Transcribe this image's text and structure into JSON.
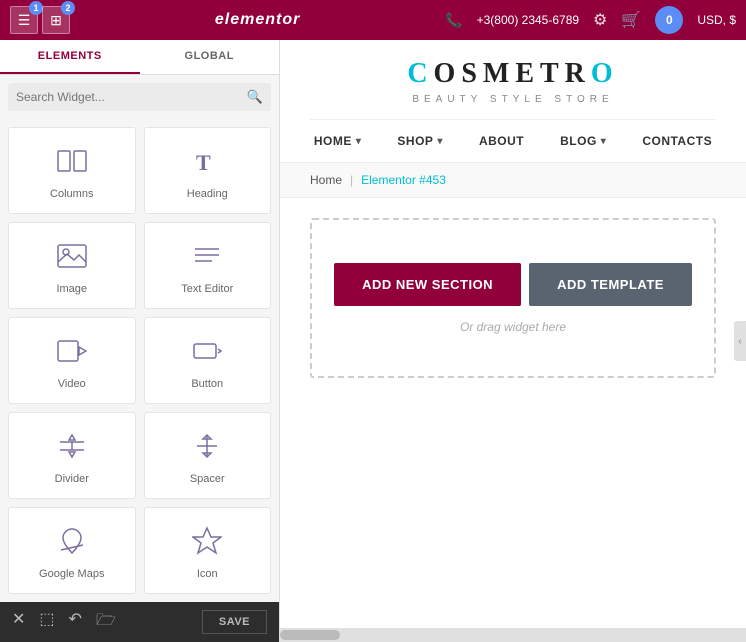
{
  "topbar": {
    "title": "elementor",
    "badge1": "1",
    "badge2": "2",
    "phone": "+3(800) 2345-6789",
    "currency": "USD, $",
    "avatar_label": "0"
  },
  "sidebar": {
    "tab_elements": "ELEMENTS",
    "tab_global": "GLOBAL",
    "search_placeholder": "Search Widget...",
    "widgets": [
      {
        "id": "columns",
        "label": "Columns",
        "icon": "columns"
      },
      {
        "id": "heading",
        "label": "Heading",
        "icon": "heading"
      },
      {
        "id": "image",
        "label": "Image",
        "icon": "image"
      },
      {
        "id": "text-editor",
        "label": "Text Editor",
        "icon": "text-editor"
      },
      {
        "id": "video",
        "label": "Video",
        "icon": "video"
      },
      {
        "id": "button",
        "label": "Button",
        "icon": "button"
      },
      {
        "id": "divider",
        "label": "Divider",
        "icon": "divider"
      },
      {
        "id": "spacer",
        "label": "Spacer",
        "icon": "spacer"
      },
      {
        "id": "google-maps",
        "label": "Google Maps",
        "icon": "maps"
      },
      {
        "id": "icon",
        "label": "Icon",
        "icon": "icon"
      }
    ]
  },
  "toolbar": {
    "save_label": "SAVE"
  },
  "site": {
    "logo_t": "C",
    "logo_o1": "O",
    "logo_s": "S",
    "logo_m": "M",
    "logo_e": "E",
    "logo_t2": "T",
    "logo_r": "R",
    "logo_o2": "O",
    "logo_full": "COSMETRO",
    "tagline": "BEAUTY STYLE STORE",
    "nav": [
      {
        "label": "HOME",
        "has_dropdown": true
      },
      {
        "label": "SHOP",
        "has_dropdown": true
      },
      {
        "label": "ABOUT",
        "has_dropdown": false
      },
      {
        "label": "BLOG",
        "has_dropdown": true
      },
      {
        "label": "CONTACTS",
        "has_dropdown": false
      }
    ]
  },
  "breadcrumb": {
    "home": "Home",
    "separator": "|",
    "current": "Elementor #453"
  },
  "editor_zone": {
    "btn_add_section": "ADD NEW SECTION",
    "btn_add_template": "ADD TEMPLATE",
    "drag_hint": "Or drag widget here"
  }
}
